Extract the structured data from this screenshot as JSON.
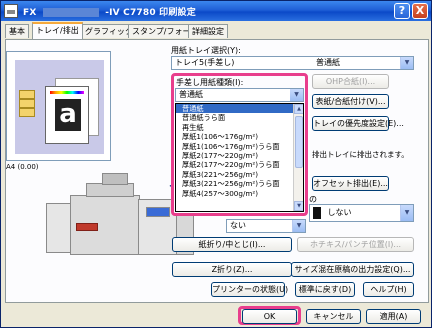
{
  "window": {
    "title_prefix": "FX",
    "title_main": "-IV C7780 印刷設定",
    "help_label": "?",
    "close_label": "X"
  },
  "tabs": [
    {
      "label": "基本"
    },
    {
      "label": "トレイ/排出"
    },
    {
      "label": "グラフィックス"
    },
    {
      "label": "スタンプ/フォーム"
    },
    {
      "label": "詳細設定"
    }
  ],
  "preview": {
    "letter": "a",
    "paper_size": "A4 (0.00)"
  },
  "tray": {
    "select_label": "用紙トレイ選択(Y):",
    "tray_value": "トレイ5(手差し)",
    "paper_value": "普通紙"
  },
  "paper_type": {
    "label": "手差し用紙種類(I):",
    "value": "普通紙",
    "options": [
      "普通紙",
      "普通紙うら面",
      "再生紙",
      "厚紙1(106〜176g/m²)",
      "厚紙1(106〜176g/m²)うら面",
      "厚紙2(177〜220g/m²)",
      "厚紙2(177〜220g/m²)うら面",
      "厚紙3(221〜256g/m²)",
      "厚紙3(221〜256g/m²)うら面",
      "厚紙4(257〜300g/m²)"
    ],
    "selected_index": 0
  },
  "buttons": {
    "ohp": "OHP合紙(I)...",
    "cover": "表紙/合紙付け(V)...",
    "tray_priority": "トレイの優先度設定(E)...",
    "offset": "オフセット排出(E)...",
    "fold": "紙折り/中とじ(I)...",
    "hole": "ホチキス/パンチ位置(I)...",
    "z_fold": "Z折り(Z)...",
    "mixed_size": "サイズ混在原稿の出力設定(Q)...",
    "printer_status": "プリンターの状態(U)",
    "restore_default": "標準に戻す(D)",
    "help": "ヘルプ(H)",
    "ok": "OK",
    "cancel": "キャンセル",
    "apply": "適用(A)"
  },
  "output": {
    "note": "排出トレイに排出されます。",
    "staple_partial": "の",
    "staple_value": "しない",
    "small_value": "ない"
  }
}
